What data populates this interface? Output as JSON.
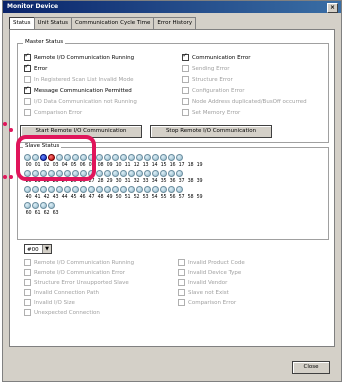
{
  "window": {
    "title": "Monitor Device",
    "close_glyph": "×"
  },
  "tabs": [
    "Status",
    "Unit Status",
    "Communication Cycle Time",
    "Error History"
  ],
  "master_status": {
    "group_label": "Master Status",
    "left": [
      {
        "label": "Remote I/O Communication Running",
        "checked": true,
        "enabled": true
      },
      {
        "label": "Error",
        "checked": true,
        "enabled": true
      },
      {
        "label": "In Registered Scan List Invalid Mode",
        "checked": false,
        "enabled": false
      },
      {
        "label": "Message Communication Permitted",
        "checked": true,
        "enabled": true
      },
      {
        "label": "I/O Data Communication not Running",
        "checked": false,
        "enabled": false
      },
      {
        "label": "Comparison Error",
        "checked": false,
        "enabled": false
      }
    ],
    "right": [
      {
        "label": "Communication Error",
        "checked": true,
        "enabled": true
      },
      {
        "label": "Sending Error",
        "checked": false,
        "enabled": false
      },
      {
        "label": "Structure Error",
        "checked": false,
        "enabled": false
      },
      {
        "label": "Configuration Error",
        "checked": false,
        "enabled": false
      },
      {
        "label": "Node Address duplicated/BusOff occurred",
        "checked": false,
        "enabled": false
      },
      {
        "label": "Set Memory Error",
        "checked": false,
        "enabled": false
      }
    ]
  },
  "buttons": {
    "start": "Start Remote I/O Communication",
    "stop": "Stop Remote I/O Communication",
    "close": "Close"
  },
  "slave_status": {
    "group_label": "Slave Status",
    "row1_numbers": [
      "00",
      "01",
      "02",
      "03",
      "04",
      "05",
      "06",
      "07",
      "08",
      "09",
      "10",
      "11",
      "12",
      "13",
      "14",
      "15",
      "16",
      "17",
      "18",
      "19"
    ],
    "row2_numbers": [
      "20",
      "21",
      "22",
      "23",
      "24",
      "25",
      "26",
      "27",
      "28",
      "29",
      "30",
      "31",
      "32",
      "33",
      "34",
      "35",
      "36",
      "37",
      "38",
      "39"
    ],
    "row3_numbers": [
      "40",
      "41",
      "42",
      "43",
      "44",
      "45",
      "46",
      "47",
      "48",
      "49",
      "50",
      "51",
      "52",
      "53",
      "54",
      "55",
      "56",
      "57",
      "58",
      "59"
    ],
    "row4_numbers": [
      "60",
      "61",
      "62",
      "63"
    ],
    "led_colors": {
      "normal": "#a9c9d8",
      "blue": "#0a1fb0",
      "red": "#b00000"
    }
  },
  "detail": {
    "select_value": "#00",
    "left": [
      "Remote I/O Communication Running",
      "Remote I/O Communication Error",
      "Structure Error Unsupported Slave",
      "Invalid Connection Path",
      "Invalid I/O Size",
      "Unexpected Connection"
    ],
    "right": [
      "Invalid Product Code",
      "Invalid Device Type",
      "Invalid Vendor",
      "Slave not Exist",
      "Comparison Error"
    ]
  }
}
